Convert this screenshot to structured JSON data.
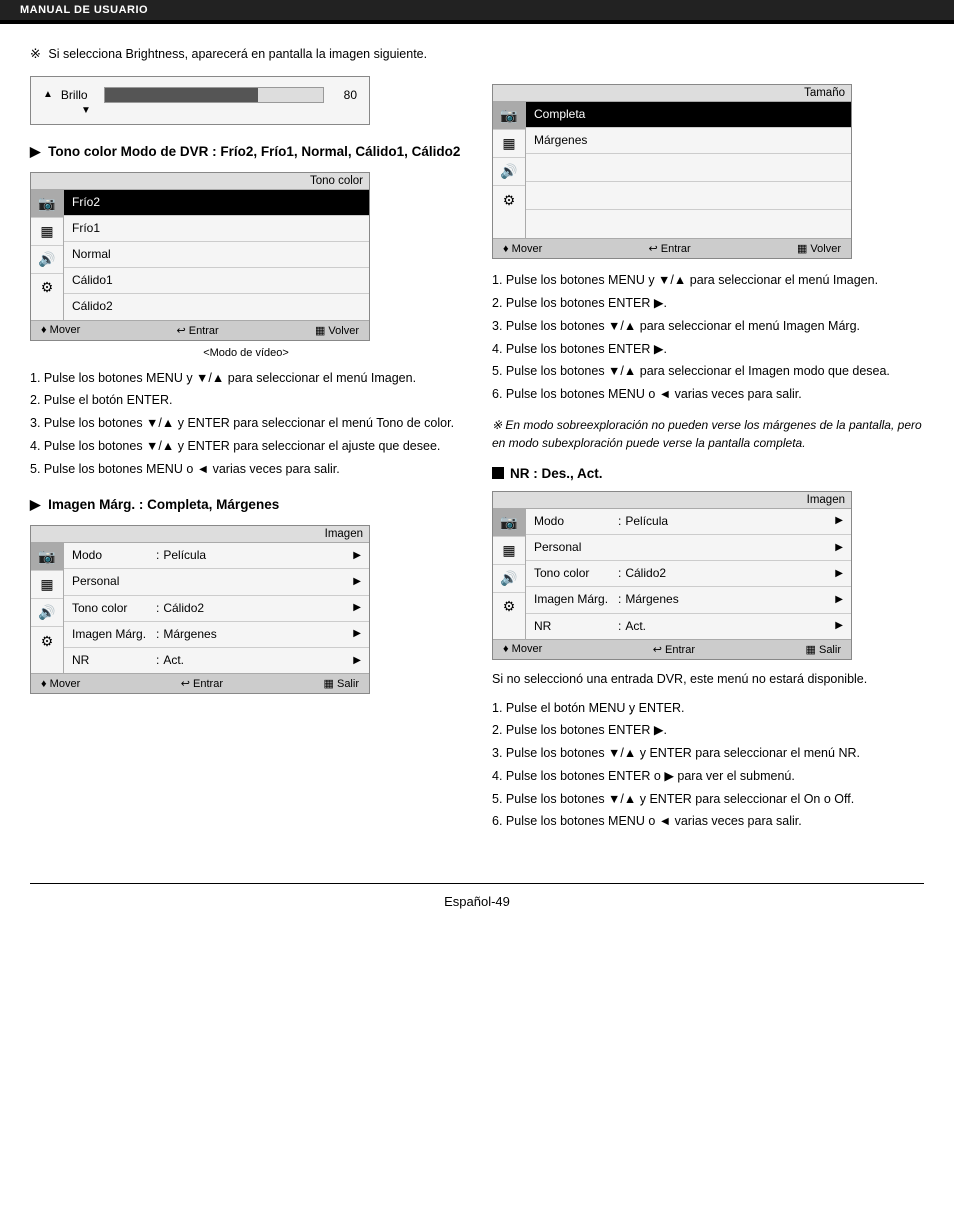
{
  "header": {
    "label": "MANUAL DE USUARIO"
  },
  "left_col": {
    "brightness_note": "Si selecciona Brightness, aparecerá en pantalla la imagen siguiente.",
    "brightness": {
      "label": "Brillo",
      "value": "80",
      "fill_percent": 70
    },
    "tono_section": {
      "heading": "Tono color Modo de DVR : Frío2, Frío1, Normal, Cálido1, Cálido2",
      "menu_title": "Tono color",
      "items": [
        "Frío2",
        "Frío1",
        "Normal",
        "Cálido1",
        "Cálido2"
      ],
      "selected_item": "Frío2",
      "footer_mover": "♦ Mover",
      "footer_entrar": "↩ Entrar",
      "footer_volver": "▦ Volver",
      "mode_label": "<Modo de vídeo>",
      "instructions": [
        "Pulse los botones MENU y ▼/▲ para seleccionar el menú Imagen.",
        "Pulse el botón ENTER.",
        "Pulse los botones ▼/▲ y ENTER para seleccionar el menú Tono de color.",
        "Pulse los botones ▼/▲ y ENTER para seleccionar el ajuste que desee.",
        "Pulse los botones MENU o ◄ varias veces para salir."
      ]
    },
    "imagen_marg_section": {
      "heading": "Imagen Márg. : Completa, Márgenes",
      "menu_title": "Imagen",
      "rows": [
        {
          "key": "Modo",
          "sep": ":",
          "val": "Película",
          "arrow": true
        },
        {
          "key": "Personal",
          "sep": "",
          "val": "",
          "arrow": true
        },
        {
          "key": "Tono color",
          "sep": ":",
          "val": "Cálido2",
          "arrow": true
        },
        {
          "key": "Imagen Márg.",
          "sep": ":",
          "val": "Márgenes",
          "arrow": true
        },
        {
          "key": "NR",
          "sep": ":",
          "val": "Act.",
          "arrow": true
        }
      ],
      "footer_mover": "♦ Mover",
      "footer_entrar": "↩ Entrar",
      "footer_salir": "▦ Salir"
    }
  },
  "right_col": {
    "tamano_menu": {
      "title": "Tamaño",
      "items": [
        "Completa",
        "Márgenes"
      ],
      "selected_item": "Completa",
      "footer_mover": "♦ Mover",
      "footer_entrar": "↩ Entrar",
      "footer_volver": "▦ Volver",
      "instructions": [
        "Pulse los botones MENU y ▼/▲ para seleccionar el menú Imagen.",
        "Pulse los botones ENTER ▶.",
        "Pulse los botones ▼/▲ para seleccionar el menú Imagen Márg.",
        "Pulse los botones ENTER ▶.",
        "Pulse los botones ▼/▲ para seleccionar el Imagen modo que desea.",
        "Pulse los botones MENU o ◄ varias veces para salir."
      ],
      "note_italic": "En modo sobreexploración no pueden verse los márgenes de la pantalla, pero en modo subexploración puede verse la pantalla completa."
    },
    "nr_section": {
      "heading": "NR : Des., Act.",
      "menu_title": "Imagen",
      "rows": [
        {
          "key": "Modo",
          "sep": ":",
          "val": "Película",
          "arrow": true
        },
        {
          "key": "Personal",
          "sep": "",
          "val": "",
          "arrow": true
        },
        {
          "key": "Tono color",
          "sep": ":",
          "val": "Cálido2",
          "arrow": true
        },
        {
          "key": "Imagen Márg.",
          "sep": ":",
          "val": "Márgenes",
          "arrow": true
        },
        {
          "key": "NR",
          "sep": ":",
          "val": "Act.",
          "arrow": true
        }
      ],
      "footer_mover": "♦ Mover",
      "footer_entrar": "↩ Entrar",
      "footer_salir": "▦ Salir",
      "intro_text": "Si no seleccionó una entrada DVR, este menú no estará disponible.",
      "instructions": [
        "Pulse el botón MENU y ENTER.",
        "Pulse los botones ENTER ▶.",
        "Pulse los botones ▼/▲ y ENTER para seleccionar el menú NR.",
        "Pulse los botones ENTER o ▶ para ver el submenú.",
        "Pulse los botones ▼/▲ y ENTER para seleccionar el On o Off.",
        "Pulse los botones MENU o ◄ varias veces para salir."
      ]
    }
  },
  "footer": {
    "page_label": "Español-49"
  }
}
